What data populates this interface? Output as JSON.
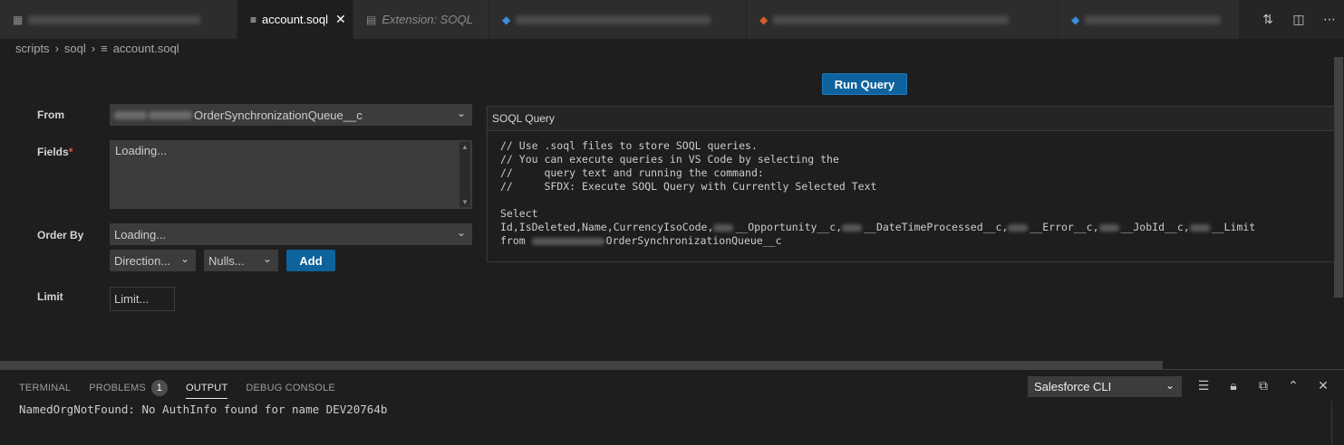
{
  "tabs": {
    "active_label": "account.soql",
    "extension_label": "Extension: SOQL"
  },
  "breadcrumb": {
    "items": [
      "scripts",
      "soql",
      "account.soql"
    ]
  },
  "editor": {
    "run_query_label": "Run Query",
    "from_label": "From",
    "from_value": "OrderSynchronizationQueue__c",
    "fields_label": "Fields",
    "fields_required": "*",
    "fields_value": "Loading...",
    "order_by_label": "Order By",
    "order_by_value": "Loading...",
    "direction_value": "Direction...",
    "nulls_value": "Nulls...",
    "add_label": "Add",
    "limit_label": "Limit",
    "limit_placeholder": "Limit..."
  },
  "soql_panel": {
    "title": "SOQL Query",
    "comment_lines": [
      "// Use .soql files to store SOQL queries.",
      "// You can execute queries in VS Code by selecting the",
      "//     query text and running the command:",
      "//     SFDX: Execute SOQL Query with Currently Selected Text"
    ],
    "select_keyword": "Select",
    "fields_prefix": "Id,IsDeleted,Name,CurrencyIsoCode,",
    "field_opportunity": "__Opportunity__c,",
    "field_datetime": "__DateTimeProcessed__c,",
    "field_error": "__Error__c,",
    "field_jobid": "__JobId__c,",
    "field_limit": "__Limit",
    "from_keyword": "from",
    "from_object": "OrderSynchronizationQueue__c"
  },
  "panel": {
    "tabs": [
      "TERMINAL",
      "PROBLEMS",
      "OUTPUT",
      "DEBUG CONSOLE"
    ],
    "problems_count": "1",
    "output_channel": "Salesforce CLI",
    "output_text": "NamedOrgNotFound: No AuthInfo found for name DEV20764b"
  }
}
